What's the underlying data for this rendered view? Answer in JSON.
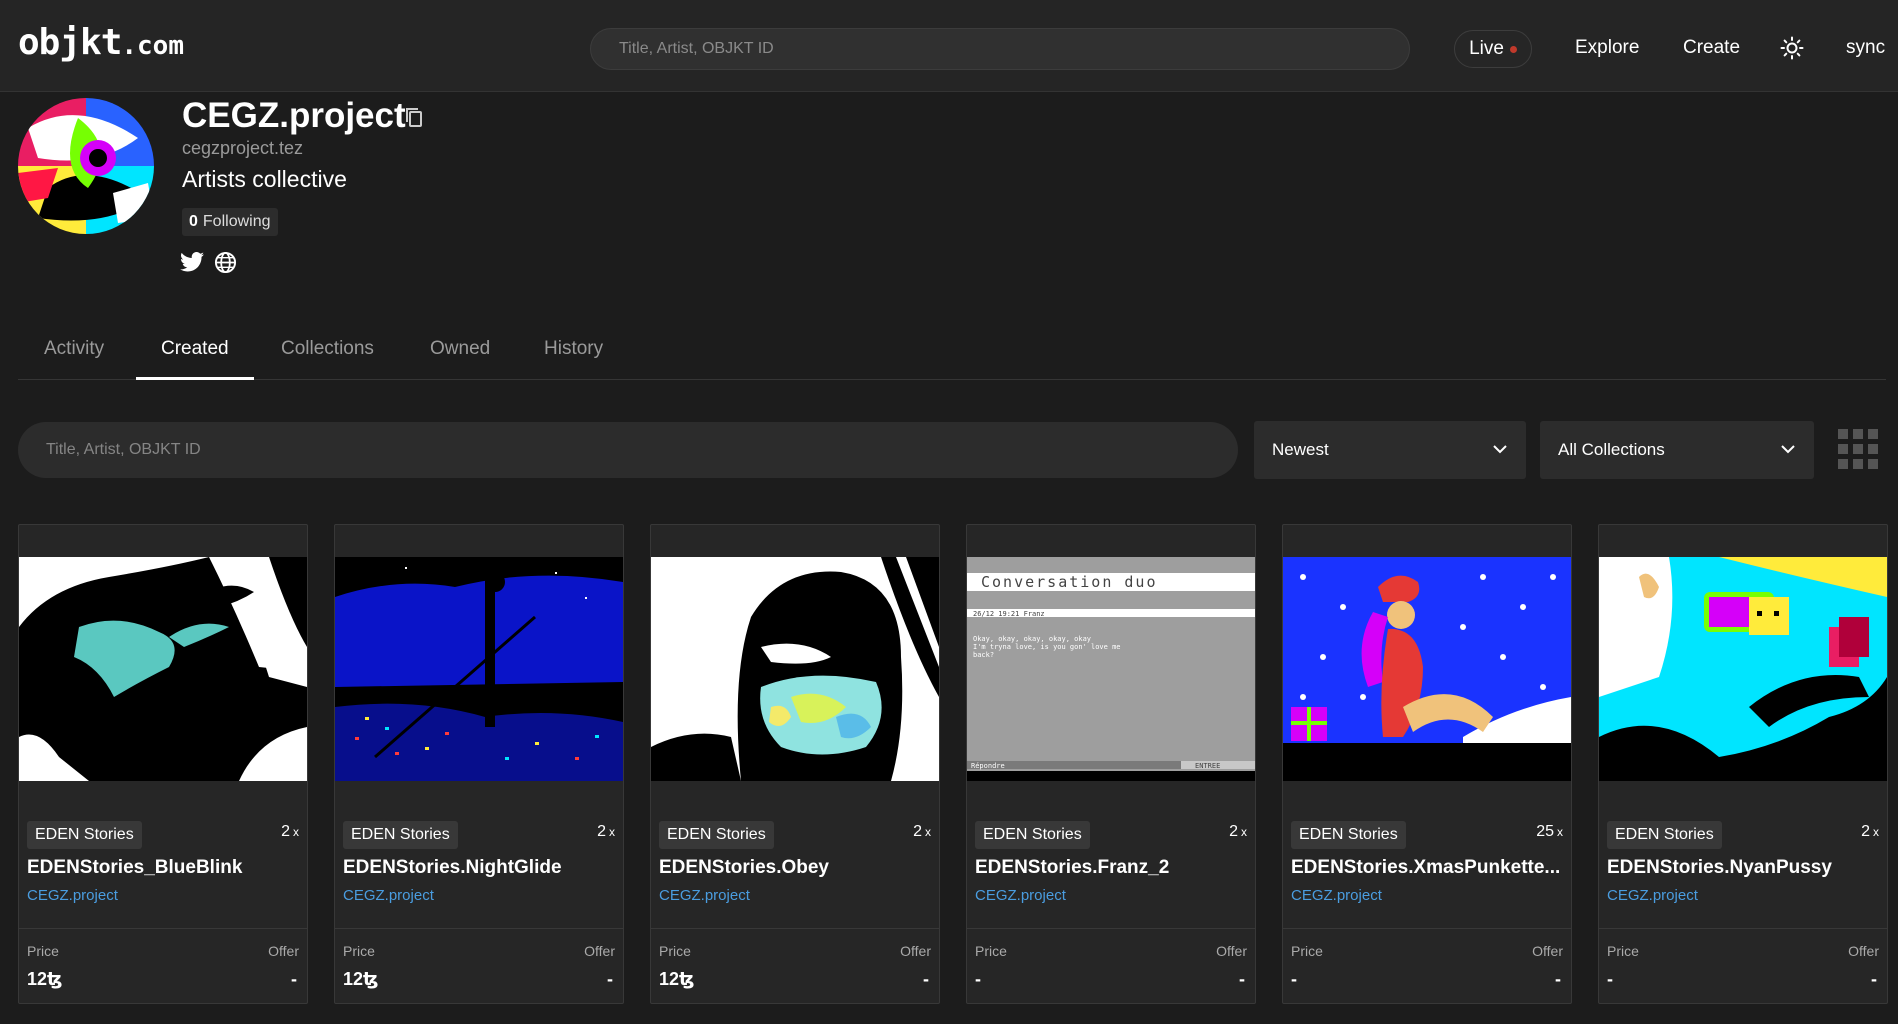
{
  "header": {
    "logo_main": "objkt",
    "logo_suffix": ".com",
    "search_placeholder": "Title, Artist, OBJKT ID",
    "live_label": "Live",
    "nav": [
      "Explore",
      "Create"
    ],
    "sync_label": "sync"
  },
  "profile": {
    "name": "CEGZ.project",
    "handle": "cegzproject.tez",
    "bio": "Artists collective",
    "following_count": "0",
    "following_label": "Following"
  },
  "tabs": [
    "Activity",
    "Created",
    "Collections",
    "Owned",
    "History"
  ],
  "active_tab": "Created",
  "filters": {
    "search_placeholder": "Title, Artist, OBJKT ID",
    "sort": "Newest",
    "collection": "All Collections"
  },
  "cards": [
    {
      "collection": "EDEN Stories",
      "editions": "2",
      "edition_suffix": "x",
      "title": "EDENStories_BlueBlink",
      "artist": "CEGZ.project",
      "price_label": "Price",
      "offer_label": "Offer",
      "price": "12ꜩ",
      "offer": "-"
    },
    {
      "collection": "EDEN Stories",
      "editions": "2",
      "edition_suffix": "x",
      "title": "EDENStories.NightGlide",
      "artist": "CEGZ.project",
      "price_label": "Price",
      "offer_label": "Offer",
      "price": "12ꜩ",
      "offer": "-"
    },
    {
      "collection": "EDEN Stories",
      "editions": "2",
      "edition_suffix": "x",
      "title": "EDENStories.Obey",
      "artist": "CEGZ.project",
      "price_label": "Price",
      "offer_label": "Offer",
      "price": "12ꜩ",
      "offer": "-"
    },
    {
      "collection": "EDEN Stories",
      "editions": "2",
      "edition_suffix": "x",
      "title": "EDENStories.Franz_2",
      "artist": "CEGZ.project",
      "price_label": "Price",
      "offer_label": "Offer",
      "price": "-",
      "offer": "-"
    },
    {
      "collection": "EDEN Stories",
      "editions": "25",
      "edition_suffix": "x",
      "title": "EDENStories.XmasPunkette...",
      "artist": "CEGZ.project",
      "price_label": "Price",
      "offer_label": "Offer",
      "price": "-",
      "offer": "-"
    },
    {
      "collection": "EDEN Stories",
      "editions": "2",
      "edition_suffix": "x",
      "title": "EDENStories.NyanPussy",
      "artist": "CEGZ.project",
      "price_label": "Price",
      "offer_label": "Offer",
      "price": "-",
      "offer": "-"
    }
  ],
  "franz_preview": {
    "heading": "Conversation duo",
    "timestamp": "26/12 19:21 Franz",
    "message_line1": "Okay, okay, okay, okay, okay",
    "message_line2": "I'm tryna love, is you gon' love me",
    "message_line3": "back?",
    "reply_label": "Répondre",
    "enter_label": "ENTREE"
  },
  "colors": {
    "background": "#1c1c1c",
    "header": "#252525",
    "card": "#262626",
    "link": "#4a9de0",
    "live_dot": "#c0392b"
  },
  "icons": [
    "copy-icon",
    "twitter-icon",
    "globe-icon",
    "sun-icon",
    "chevron-down-icon",
    "grid-view-icon"
  ]
}
